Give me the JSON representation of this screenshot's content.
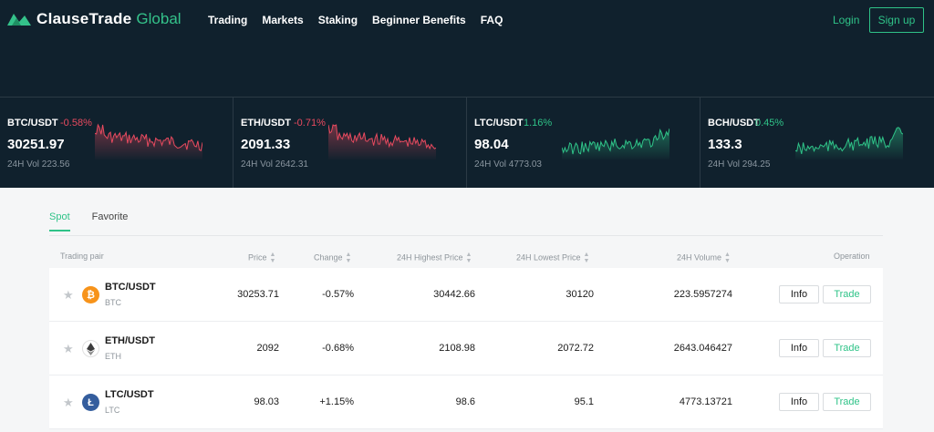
{
  "brand": {
    "name": "ClauseTrade",
    "accent": "Global",
    "color": "#34c28a"
  },
  "nav": {
    "items": [
      "Trading",
      "Markets",
      "Staking",
      "Beginner Benefits",
      "FAQ"
    ],
    "login": "Login",
    "signup": "Sign up"
  },
  "tickers": [
    {
      "pair": "BTC/USDT",
      "change": "-0.58%",
      "price": "30251.97",
      "volume": "24H Vol 223.56",
      "trend": "down"
    },
    {
      "pair": "ETH/USDT",
      "change": "-0.71%",
      "price": "2091.33",
      "volume": "24H Vol 2642.31",
      "trend": "down"
    },
    {
      "pair": "LTC/USDT",
      "change": "1.16%",
      "price": "98.04",
      "volume": "24H Vol 4773.03",
      "trend": "up"
    },
    {
      "pair": "BCH/USDT",
      "change": "0.45%",
      "price": "133.3",
      "volume": "24H Vol 294.25",
      "trend": "up"
    }
  ],
  "tabs": [
    "Spot",
    "Favorite"
  ],
  "table": {
    "headers": {
      "pair": "Trading pair",
      "price": "Price",
      "change": "Change",
      "high": "24H Highest Price",
      "low": "24H Lowest Price",
      "volume": "24H Volume",
      "operation": "Operation"
    },
    "rows": [
      {
        "pair": "BTC/USDT",
        "base": "BTC",
        "icon": "bitcoin-icon",
        "price": "30253.71",
        "change": "-0.57%",
        "high": "30442.66",
        "low": "30120",
        "volume": "223.5957274",
        "info": "Info",
        "trade": "Trade"
      },
      {
        "pair": "ETH/USDT",
        "base": "ETH",
        "icon": "ethereum-icon",
        "price": "2092",
        "change": "-0.68%",
        "high": "2108.98",
        "low": "2072.72",
        "volume": "2643.046427",
        "info": "Info",
        "trade": "Trade"
      },
      {
        "pair": "LTC/USDT",
        "base": "LTC",
        "icon": "litecoin-icon",
        "price": "98.03",
        "change": "+1.15%",
        "high": "98.6",
        "low": "95.1",
        "volume": "4773.13721",
        "info": "Info",
        "trade": "Trade"
      }
    ]
  },
  "colors": {
    "up": "#2fc388",
    "down": "#e84a5f",
    "header_bg": "#10212d"
  }
}
